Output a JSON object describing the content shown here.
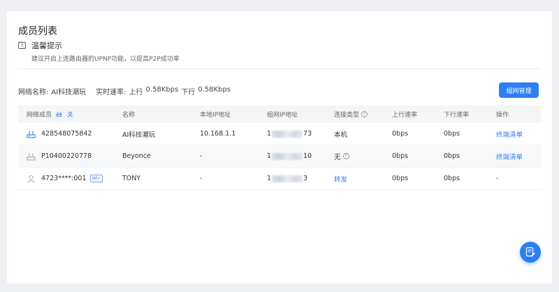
{
  "page": {
    "title": "成员列表",
    "tip_title": "温馨提示",
    "tip_text": "建议开启上连路由器的UPNP功能，以提高P2P成功率"
  },
  "network": {
    "name_label": "网络名称:",
    "name_value": "AI科技潮玩",
    "speed_label": "实时速率:",
    "up_label": "上行",
    "up_value": "0.58Kbps",
    "down_label": "下行",
    "down_value": "0.58Kbps",
    "manage_button": "组网管理"
  },
  "table": {
    "headers": {
      "member": "网络成员",
      "name": "名称",
      "local_ip": "本地IP地址",
      "network_ip": "组网IP地址",
      "conn_type": "连接类型",
      "up_rate": "上行速率",
      "down_rate": "下行速率",
      "action": "操作"
    },
    "rows": [
      {
        "member": "428548075842",
        "icon": "router-icon",
        "name": "AI科技潮玩",
        "local_ip": "10.168.1.1",
        "ip_start": "1",
        "ip_end": "73",
        "conn_type": "本机",
        "up": "0bps",
        "down": "0bps",
        "action": "终端清单"
      },
      {
        "member": "P10400220778",
        "icon": "router-gray-icon",
        "name": "Beyonce",
        "local_ip": "-",
        "ip_start": "1",
        "ip_end": "10",
        "conn_type": "无",
        "up": "0bps",
        "down": "0bps",
        "action": "终端清单"
      },
      {
        "member": "4723****:001",
        "badge": "Win",
        "icon": "user-icon",
        "name": "TONY",
        "local_ip": "-",
        "ip_start": "1",
        "ip_end": "3",
        "conn_type": "转发",
        "up": "0bps",
        "down": "0bps",
        "action": "-"
      }
    ]
  },
  "colors": {
    "accent": "#2f7ff2",
    "background": "#eef0f3"
  }
}
